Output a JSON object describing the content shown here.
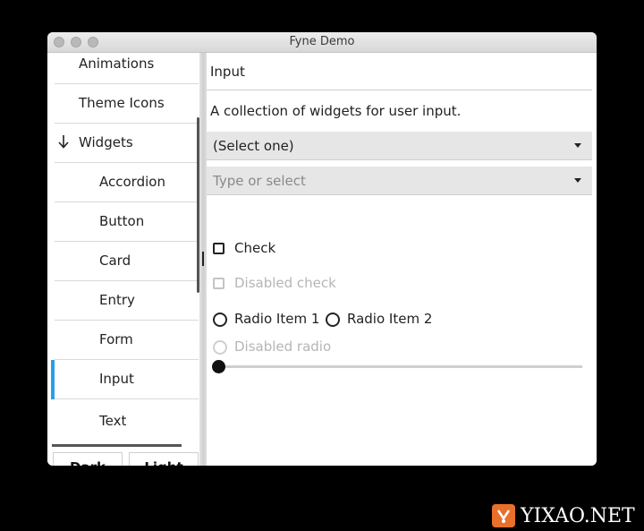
{
  "window": {
    "title": "Fyne Demo"
  },
  "sidebar": {
    "items": [
      {
        "label": "Animations",
        "indent": 0
      },
      {
        "label": "Theme Icons",
        "indent": 0
      },
      {
        "label": "Widgets",
        "indent": 0,
        "expanded": true
      },
      {
        "label": "Accordion",
        "indent": 1
      },
      {
        "label": "Button",
        "indent": 1
      },
      {
        "label": "Card",
        "indent": 1
      },
      {
        "label": "Entry",
        "indent": 1
      },
      {
        "label": "Form",
        "indent": 1
      },
      {
        "label": "Input",
        "indent": 1,
        "selected": true
      },
      {
        "label": "Text",
        "indent": 1
      }
    ],
    "dark_label": "Dark",
    "light_label": "Light"
  },
  "main": {
    "title": "Input",
    "intro": "A collection of widgets for user input.",
    "select": {
      "value": "(Select one)"
    },
    "select_entry": {
      "placeholder": "Type or select"
    },
    "check": {
      "label": "Check",
      "checked": false
    },
    "disabled_check": {
      "label": "Disabled check"
    },
    "radio_items": [
      "Radio Item 1",
      "Radio Item 2"
    ],
    "disabled_radio": {
      "label": "Disabled radio"
    },
    "slider": {
      "value": 0
    }
  },
  "colors": {
    "accent": "#2b9de9",
    "background": "#ffffff",
    "select_bg": "#e6e6e6",
    "watermark_logo": "#e8702a"
  },
  "watermark": {
    "text": "YIXAO.NET"
  }
}
